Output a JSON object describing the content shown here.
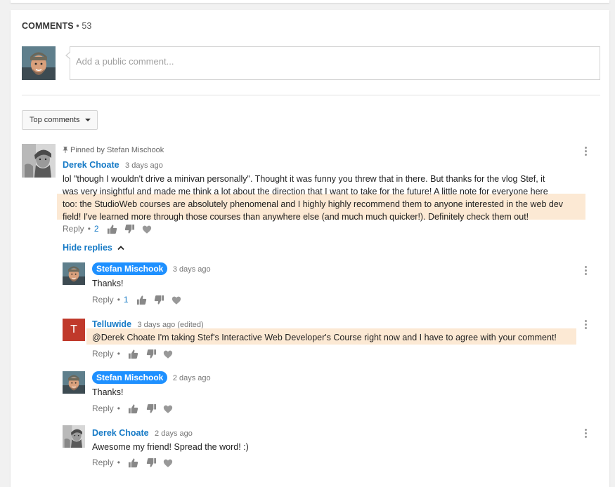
{
  "header": {
    "title": "COMMENTS",
    "separator": "•",
    "count": "53"
  },
  "composer": {
    "placeholder": "Add a public comment..."
  },
  "sort": {
    "label": "Top comments"
  },
  "pinned_label": "Pinned by Stefan Mischook",
  "actions": {
    "reply": "Reply",
    "dot": "•"
  },
  "top_comment": {
    "author": "Derek Choate",
    "time": "3 days ago",
    "text_lines": [
      "lol \"though I wouldn't drive a minivan personally\". Thought it was funny you threw that in there. But thanks for the vlog Stef, it",
      "was very insightful and made me think a lot about the direction that I want to take for the future! A little note for everyone here",
      "StudioWeb courses are absolutely phenomenal and I highly highly recommend them to anyone interested in the web dev",
      "field! I've learned more through those courses than anywhere else (and much much quicker!). Definitely check them out!"
    ],
    "line3_prefix": "too: the ",
    "likes": "2"
  },
  "hide_replies": "Hide replies",
  "replies": [
    {
      "author": "Stefan Mischook",
      "time": "3 days ago",
      "text": "Thanks!",
      "likes": "1"
    },
    {
      "author": "Telluwide",
      "time": "3 days ago (edited)",
      "avatar_letter": "T",
      "text": "@Derek Choate I'm taking Stef's Interactive Web Developer's Course right now and I have to agree with your comment!",
      "likes": ""
    },
    {
      "author": "Stefan Mischook",
      "time": "2 days ago",
      "text": "Thanks!",
      "likes": ""
    },
    {
      "author": "Derek Choate",
      "time": "2 days ago",
      "text": "Awesome my friend! Spread the word! :)",
      "likes": ""
    }
  ],
  "colors": {
    "link": "#167ac6",
    "badge": "#1e90ff",
    "highlight": "#fce9d4",
    "telluwide_avatar": "#c0392b"
  }
}
